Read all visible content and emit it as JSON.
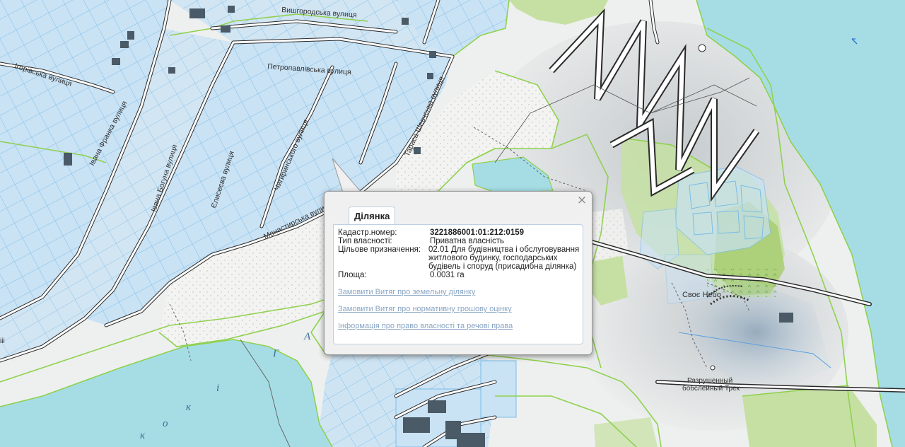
{
  "map": {
    "labels": {
      "vyshhorodska": "Вишгородська вулиця",
      "ihorivska": "Ігорівська вулиця",
      "petropavlivska": "Петропавлівська вулиця",
      "ivana_franka": "Івана Франка вулиця",
      "ivana_bohuna": "Івана Богуна вулиця",
      "yelyseeva": "Єлисеєва вулиця",
      "chyhyrynskoho": "Чигиринського вулиця",
      "monastyrska": "Монастирська вулиця",
      "tarasa": "Тараса Шевченка вулиця",
      "svoie_nebo": "Своє Небо",
      "ruined_track_1": "Разрушенный",
      "ruined_track_2": "бобслейный Трек",
      "edge_ii": "ііі",
      "water_g": "Г",
      "water_a": "А",
      "water_i": "і",
      "water_ko": "к",
      "water_o": "о",
      "water_k2": "к"
    }
  },
  "popup": {
    "close_symbol": "×",
    "tab_title": "Ділянка",
    "rows": [
      {
        "key": "Кадастр.номер:",
        "value": "3221886001:01:212:0159"
      },
      {
        "key": "Тип власності:",
        "value": "Приватна власність"
      },
      {
        "key": "Цільове призначення:",
        "value": "02.01 Для будівництва і обслуговування житлового будинку, господарських будівель і споруд (присадибна ділянка)"
      },
      {
        "key": "Площа:",
        "value": "0.0031 га"
      }
    ],
    "links": [
      "Замовити Витяг про земельну ділянку",
      "Замовити Витяг про нормативну грошову оцінку",
      "Інформація про право власності та речові права"
    ]
  },
  "colors": {
    "water": "#a6dde5",
    "parcel_fill": "#c9e2f4",
    "parcel_stroke": "#79bde8",
    "boundary_green": "#8fd14f",
    "road": "#2b2b2b",
    "link": "#8aa6c4"
  }
}
